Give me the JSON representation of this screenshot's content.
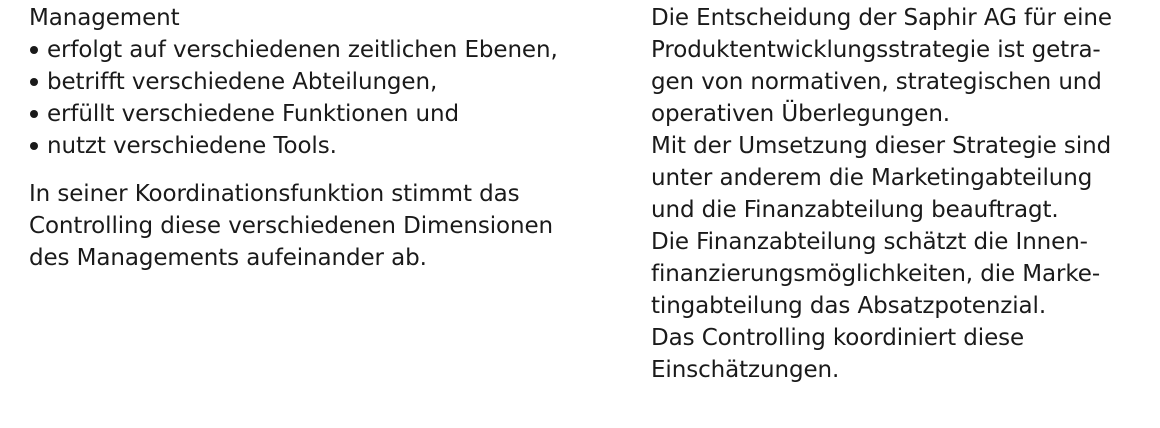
{
  "left_column": {
    "heading": "Management",
    "bullets": [
      "erfolgt auf verschiedenen zeitlichen Ebenen,",
      "betrifft verschiedene Abteilungen,",
      "erfüllt verschiedene Funktionen und",
      "nutzt verschiedene Tools."
    ],
    "paragraph_lines": [
      "In seiner Koordinationsfunktion stimmt das",
      "Controlling diese verschiedenen Dimensionen",
      "des Managements aufeinander ab."
    ]
  },
  "right_column": {
    "lines": [
      "Die Entscheidung der Saphir AG für eine",
      "Produktentwicklungsstrategie ist getra-",
      "gen von normativen, strategischen und",
      "operativen Überlegungen.",
      "Mit der Umsetzung dieser Strategie sind",
      "unter anderem die Marketingabteilung",
      "und die Finanzabteilung beauftragt.",
      "Die Finanzabteilung schätzt die Innen-",
      "finanzierungsmöglichkeiten, die Marke-",
      "tingabteilung das Absatzpotenzial.",
      "Das Controlling koordiniert diese",
      "Einschätzungen."
    ]
  }
}
